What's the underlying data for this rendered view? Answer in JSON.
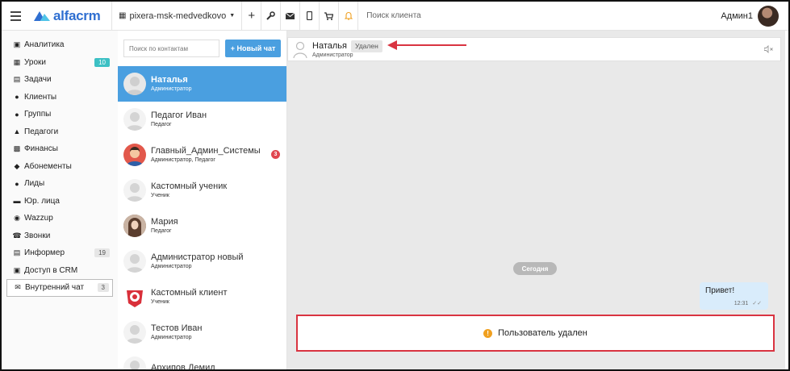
{
  "app": {
    "name": "alfacrm"
  },
  "topbar": {
    "branch": "pixera-msk-medvedkovo",
    "search_placeholder": "Поиск клиента",
    "user_name": "Админ1",
    "icons": [
      "plus-icon",
      "wrench-icon",
      "envelope-icon",
      "mobile-icon",
      "cart-icon",
      "bell-icon"
    ]
  },
  "sidebar": {
    "items": [
      {
        "label": "Аналитика",
        "icon": "book-icon"
      },
      {
        "label": "Уроки",
        "icon": "calendar-icon",
        "badge": "10"
      },
      {
        "label": "Задачи",
        "icon": "clipboard-icon"
      },
      {
        "label": "Клиенты",
        "icon": "user-icon"
      },
      {
        "label": "Группы",
        "icon": "users-icon"
      },
      {
        "label": "Педагоги",
        "icon": "graduation-cap-icon"
      },
      {
        "label": "Финансы",
        "icon": "money-icon"
      },
      {
        "label": "Абонементы",
        "icon": "tag-icon"
      },
      {
        "label": "Лиды",
        "icon": "user-plus-icon"
      },
      {
        "label": "Юр. лица",
        "icon": "briefcase-icon"
      },
      {
        "label": "Wazzup",
        "icon": "whatsapp-icon"
      },
      {
        "label": "Звонки",
        "icon": "phone-icon"
      },
      {
        "label": "Информер",
        "icon": "list-icon",
        "badge": "19"
      },
      {
        "label": "Доступ в CRM",
        "icon": "lock-icon"
      },
      {
        "label": "Внутренний чат",
        "icon": "envelope-icon",
        "badge": "3"
      }
    ]
  },
  "contacts": {
    "search_placeholder": "Поиск по контактам",
    "new_chat_label": "+ Новый чат",
    "list": [
      {
        "name": "Наталья",
        "role": "Администратор"
      },
      {
        "name": "Педагог Иван",
        "role": "Педагог"
      },
      {
        "name": "Главный_Админ_Системы",
        "role": "Администратор, Педагог",
        "unread": "3"
      },
      {
        "name": "Кастомный ученик",
        "role": "Ученик"
      },
      {
        "name": "Мария",
        "role": "Педагог"
      },
      {
        "name": "Администратор новый",
        "role": "Администратор"
      },
      {
        "name": "Кастомный клиент",
        "role": "Ученик"
      },
      {
        "name": "Тестов Иван",
        "role": "Администратор"
      },
      {
        "name": "Архипов Демид",
        "role": ""
      }
    ]
  },
  "chat": {
    "name": "Наталья",
    "status": "Удален",
    "role": "Администратор",
    "date_label": "Сегодня",
    "message_text": "Привет!",
    "message_time": "12:31",
    "deleted_notice": "Пользователь удален"
  },
  "colors": {
    "accent": "#4a9fe0",
    "alert": "#d93441",
    "teal": "#3cc0c4"
  }
}
